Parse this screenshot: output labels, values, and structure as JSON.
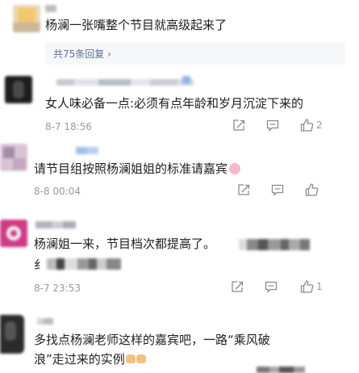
{
  "comments": [
    {
      "text": "杨澜一张嘴整个节目就高级起来了",
      "replies_label": "共75条回复 ›"
    },
    {
      "text": "女人味必备一点:必须有点年龄和岁月沉淀下来的",
      "date": "8-7 18:56",
      "like_count": "2"
    },
    {
      "text": "请节目组按照杨澜姐姐的标准请嘉宾",
      "date": "8-8 00:04",
      "like_count": ""
    },
    {
      "text": "杨澜姐一来，节目档次都提高了。",
      "text_line2": "纟",
      "date": "8-7 23:53",
      "like_count": "1"
    },
    {
      "text": "多找点杨澜老师这样的嘉宾吧，一路“乘风破",
      "text_line2": "浪”走过来的实例"
    }
  ],
  "icons": {
    "share": "share-icon",
    "comment": "comment-icon",
    "like": "like-icon"
  },
  "colors": {
    "text": "#1e1e1e",
    "meta": "#9a9a9a",
    "reply_link": "#5a7196",
    "reply_bg": "#f6f7f9"
  }
}
